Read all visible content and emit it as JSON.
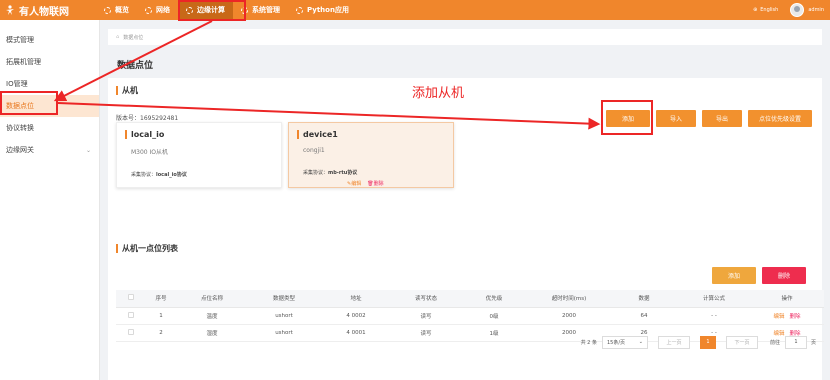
{
  "app": {
    "title": "有人物联网"
  },
  "nav": {
    "items": [
      {
        "label": "概览"
      },
      {
        "label": "网络"
      },
      {
        "label": "边缘计算"
      },
      {
        "label": "系统管理"
      },
      {
        "label": "Python应用"
      }
    ],
    "active_index": 2,
    "language": "English",
    "user": "admin"
  },
  "sidebar": {
    "items": [
      {
        "label": "模式管理"
      },
      {
        "label": "拓展机管理"
      },
      {
        "label": "IO管理"
      },
      {
        "label": "数据点位"
      },
      {
        "label": "协议转换"
      },
      {
        "label": "边缘网关"
      }
    ],
    "active_index": 3
  },
  "breadcrumb": {
    "text": "数据点位"
  },
  "page": {
    "title": "数据点位"
  },
  "slave_panel": {
    "title": "从机",
    "version_label": "版本号：1695292481",
    "buttons": {
      "add": "添加",
      "import": "导入",
      "export": "导出",
      "priority": "点位优先级设置"
    },
    "cards": [
      {
        "name": "local_io",
        "desc": "M300 IO从机",
        "proto_label": "采集协议：",
        "proto_value": "local_io协议"
      },
      {
        "name": "device1",
        "desc": "congji1",
        "proto_label": "采集协议：",
        "proto_value": "mb-rtu协议",
        "edit": "编辑",
        "delete": "删除"
      }
    ]
  },
  "list_panel": {
    "title": "从机一点位列表",
    "buttons": {
      "add": "添加",
      "delete": "删除"
    },
    "columns": [
      "序号",
      "点位名称",
      "数据类型",
      "地址",
      "读写状态",
      "优先级",
      "超时时间(ms)",
      "数据",
      "计算公式",
      "操作"
    ],
    "rows": [
      {
        "idx": "1",
        "name": "温度",
        "type": "ushort",
        "addr": "4 0002",
        "rw": "读写",
        "priority": "0级",
        "timeout": "2000",
        "data": "64",
        "formula": "- -",
        "edit": "编辑",
        "delete": "删除"
      },
      {
        "idx": "2",
        "name": "湿度",
        "type": "ushort",
        "addr": "4 0001",
        "rw": "读写",
        "priority": "1级",
        "timeout": "2000",
        "data": "26",
        "formula": "- -",
        "edit": "编辑",
        "delete": "删除"
      }
    ]
  },
  "pagination": {
    "total": "共 2 条",
    "page_size": "15条/页",
    "prev": "上一页",
    "current": "1",
    "next": "下一页",
    "goto_label": "前往",
    "goto_value": "1",
    "page_suffix": "页"
  },
  "annotation": {
    "text": "添加从机",
    "color": "#ec2626"
  },
  "colors": {
    "accent": "#f0862c",
    "danger": "#ee2a63",
    "active_bg": "#fde6d2"
  }
}
